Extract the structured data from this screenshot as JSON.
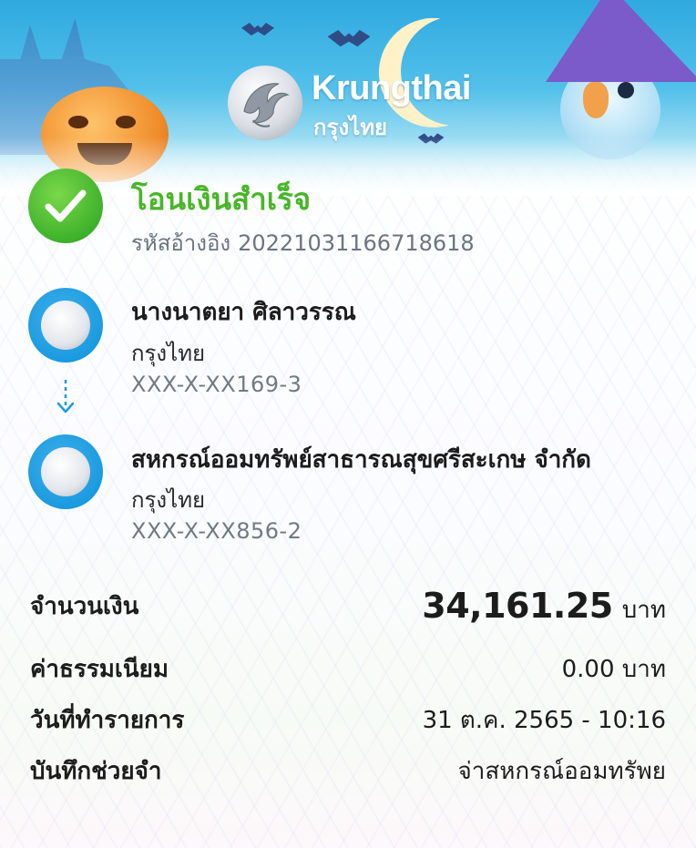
{
  "header": {
    "brand_en": "Krungthai",
    "brand_th": "กรุงไทย"
  },
  "status": {
    "title": "โอนเงินสำเร็จ",
    "ref_label": "รหัสอ้างอิง",
    "ref_value": "2022103116671861​8",
    "icon": "check-circle-icon",
    "color": "#48b628"
  },
  "sender": {
    "name": "นางนาตยา ศิลาวรรณ",
    "bank": "กรุงไทย",
    "account": "XXX-X-XX169-3"
  },
  "receiver": {
    "name": "สหกรณ์ออมทรัพย์สาธารณสุขศรีสะเกษ จำกัด",
    "bank": "กรุงไทย",
    "account": "XXX-X-XX856-2"
  },
  "details": {
    "amount_label": "จำนวนเงิน",
    "amount_value": "34,161.25",
    "amount_unit": "บาท",
    "fee_label": "ค่าธรรมเนียม",
    "fee_value": "0.00 บาท",
    "date_label": "วันที่ทำรายการ",
    "date_value": "31 ต.ค. 2565 - 10:16",
    "memo_label": "บันทึกช่วยจำ",
    "memo_value": "จ่าสหกรณ์ออมทรัพย"
  },
  "colors": {
    "accent": "#1b9be0",
    "success": "#48b628"
  }
}
